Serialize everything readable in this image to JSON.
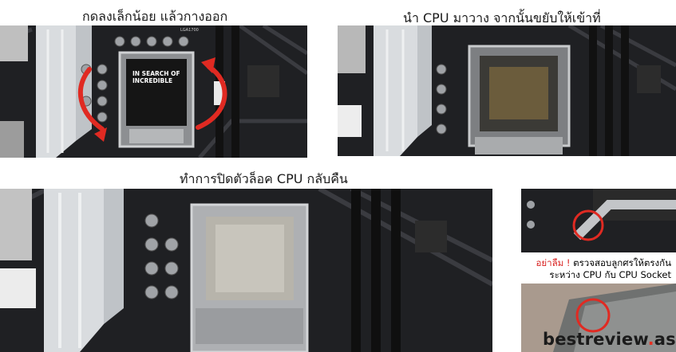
{
  "captions": {
    "step1": "กดลงเล็กน้อย แล้วกางออก",
    "step2": "นำ CPU มาวาง จากนั้นขยับให้เข้าที่",
    "step3": "ทำการปิดตัวล็อค CPU กลับคืน"
  },
  "panel1_print": {
    "socket_label": "LGA1700",
    "box_line1": "IN SEARCH OF",
    "box_line2": "INCREDIBLE"
  },
  "note": {
    "warning": "อย่าลืม !",
    "line1_rest": " ตรวจสอบลูกศรให้ตรงกัน",
    "line2": "ระหว่าง CPU กับ CPU Socket"
  },
  "watermark": {
    "name": "bestreview",
    "dot": ".",
    "tld": "asia"
  },
  "colors": {
    "accent_red": "#e02a22",
    "board": "#1e1f22",
    "heatsink": "#d9dcdf"
  }
}
